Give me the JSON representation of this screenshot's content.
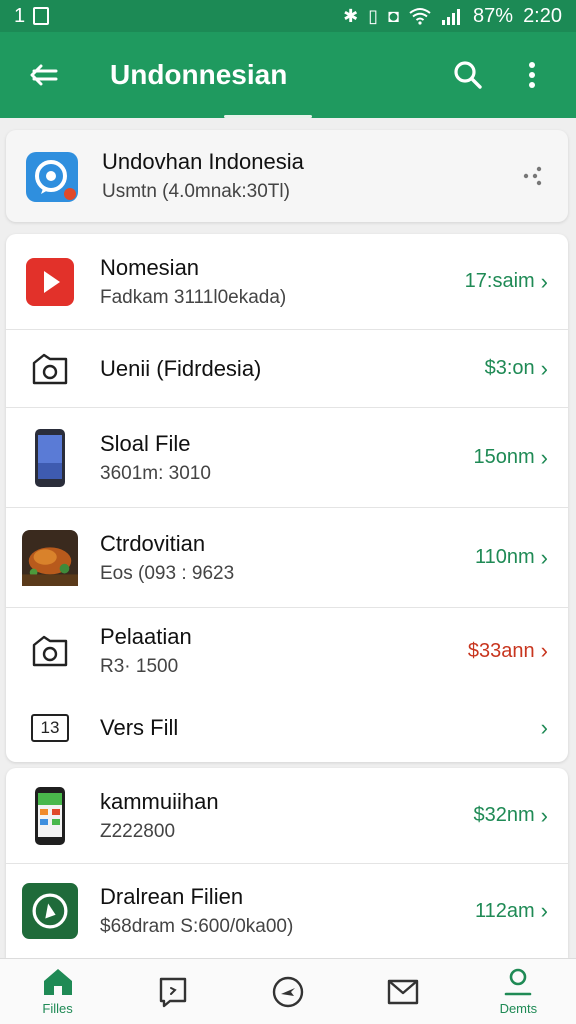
{
  "status_bar": {
    "left_text": "1",
    "battery": "87%",
    "time": "2:20"
  },
  "app_bar": {
    "title": "Undonnesian"
  },
  "featured": {
    "title": "Undovhan Indonesia",
    "subtitle": "Usmtn (4.0mnak:30Tl)"
  },
  "list1": [
    {
      "title": "Nomesian",
      "subtitle": "Fadkam 3111l0ekada)",
      "meta": "17:saim",
      "alert": false,
      "icon": "video-play-icon"
    },
    {
      "title": "Uenii (Fidrdesia)",
      "subtitle": "",
      "meta": "$3:on",
      "alert": false,
      "icon": "camera-folder-icon"
    },
    {
      "title": "Sloal File",
      "subtitle": "3601m: 3010",
      "meta": "15onm",
      "alert": false,
      "icon": "phone-icon"
    },
    {
      "title": "Ctrdovitian",
      "subtitle": "Eos (093 : 9623",
      "meta": "110nm",
      "alert": false,
      "icon": "food-photo-icon"
    },
    {
      "title": "Pelaatian",
      "subtitle": "R3· 1500",
      "meta": "$33ann",
      "alert": true,
      "icon": "camera-folder-icon"
    },
    {
      "title": "Vers Fill",
      "subtitle": "",
      "meta": "",
      "alert": false,
      "icon": "calendar-13-icon",
      "icon_text": "13"
    }
  ],
  "list2": [
    {
      "title": "kammuiihan",
      "subtitle": "Z222800",
      "meta": "$32nm",
      "alert": false,
      "icon": "phone-app-icon"
    },
    {
      "title": "Dralrean Filien",
      "subtitle": "$68dram S:600/0ka00)",
      "meta": "112am",
      "alert": false,
      "icon": "compass-app-icon"
    }
  ],
  "bottom_nav": [
    {
      "label": "Filles",
      "icon": "home-icon"
    },
    {
      "label": "",
      "icon": "message-icon"
    },
    {
      "label": "",
      "icon": "compass-icon"
    },
    {
      "label": "",
      "icon": "mail-icon"
    },
    {
      "label": "Demts",
      "icon": "person-icon"
    }
  ],
  "colors": {
    "status_bar": "#1c8a55",
    "app_bar": "#1f9a5f",
    "accent": "#1f8a55",
    "alert": "#c8361f"
  }
}
